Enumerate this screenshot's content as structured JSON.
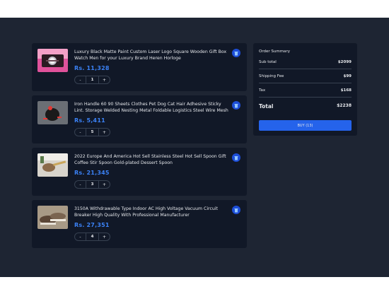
{
  "cart": {
    "items": [
      {
        "title": "Luxury Black Matte Paint Custom Laser Logo Square Wooden Gift Box Watch Men for your Luxury Brand Heren Horloge",
        "price": "Rs. 11,328",
        "quantity": "1",
        "minus_label": "-",
        "plus_label": "+",
        "image_icon": "watch-box-image"
      },
      {
        "title": "Iron Handle 60 90 Sheets Clothes Pet Dog Cat Hair Adhesive Sticky Lint. Storage Welded Nesting Metal Foldable Logistics Steel Wire Mesh",
        "price": "Rs. 5,411",
        "quantity": "5",
        "minus_label": "-",
        "plus_label": "+",
        "image_icon": "lint-roller-image"
      },
      {
        "title": "2022 Europe And America Hot Sell Stainless Steel Hot Sell Spoon Gift Coffee Stir Spoon Gold-plated Dessert Spoon",
        "price": "Rs. 21,345",
        "quantity": "3",
        "minus_label": "-",
        "plus_label": "+",
        "image_icon": "spoon-image"
      },
      {
        "title": "3150A Withdrawable Type Indoor AC High Voltage Vacuum Circuit Breaker High Quality With Professional Manufacturer",
        "price": "Rs. 27,351",
        "quantity": "4",
        "minus_label": "-",
        "plus_label": "+",
        "image_icon": "shoes-image"
      }
    ]
  },
  "summary": {
    "title": "Order Summary",
    "subtotal_label": "Sub total",
    "subtotal_value": "$2099",
    "shipping_label": "Shipping Fee",
    "shipping_value": "$99",
    "tax_label": "Tax",
    "tax_value": "$168",
    "total_label": "Total",
    "total_value": "$2238",
    "buy_label": "BUY (13)"
  },
  "colors": {
    "background": "#1e2533",
    "card": "#111827",
    "accent": "#3b82f6",
    "button": "#2563eb"
  }
}
